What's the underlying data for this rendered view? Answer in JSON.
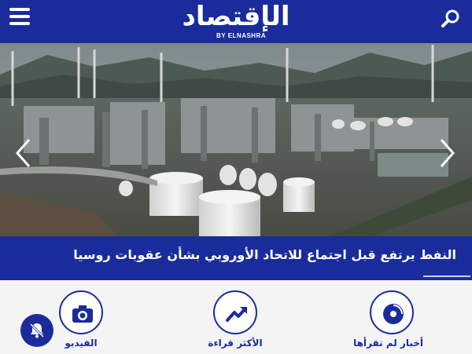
{
  "header": {
    "logo_text": "الإقتصاد",
    "logo_sub": "BY ELNASHRA",
    "menu_icon": "hamburger-menu-icon",
    "search_icon": "search-icon"
  },
  "slider": {
    "headline": "النفط يرتفع قبل اجتماع للاتحاد الأوروبي بشأن عقوبات روسيا",
    "prev_icon": "chevron-left-icon",
    "next_icon": "chevron-right-icon"
  },
  "shortcuts": [
    {
      "label": "أخبار لم تقرأها",
      "icon": "unread-news-icon"
    },
    {
      "label": "الأكثر قراءة",
      "icon": "trending-up-icon"
    },
    {
      "label": "الفيديو",
      "icon": "camera-icon"
    }
  ],
  "notifications": {
    "icon": "bell-off-icon"
  },
  "colors": {
    "brand_blue": "#1a2c9c",
    "background": "#f4f4f4"
  }
}
